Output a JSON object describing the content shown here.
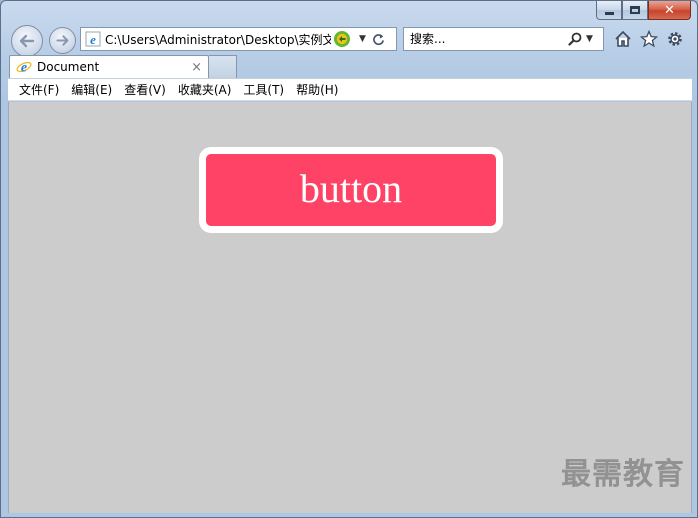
{
  "window": {
    "caption": {
      "minimize_icon": "minimize-icon",
      "maximize_icon": "maximize-icon",
      "close_icon": "close-icon",
      "close_glyph": "✕"
    }
  },
  "navigation": {
    "address": "C:\\Users\\Administrator\\Desktop\\实例文",
    "search_placeholder": "搜索..."
  },
  "tab": {
    "title": "Document",
    "close_glyph": "×"
  },
  "menu": {
    "items": [
      "文件(F)",
      "编辑(E)",
      "查看(V)",
      "收藏夹(A)",
      "工具(T)",
      "帮助(H)"
    ]
  },
  "page": {
    "button_label": "button",
    "button_color": "#ff4366",
    "background_color": "#cccccc"
  },
  "watermark": "最需教育"
}
